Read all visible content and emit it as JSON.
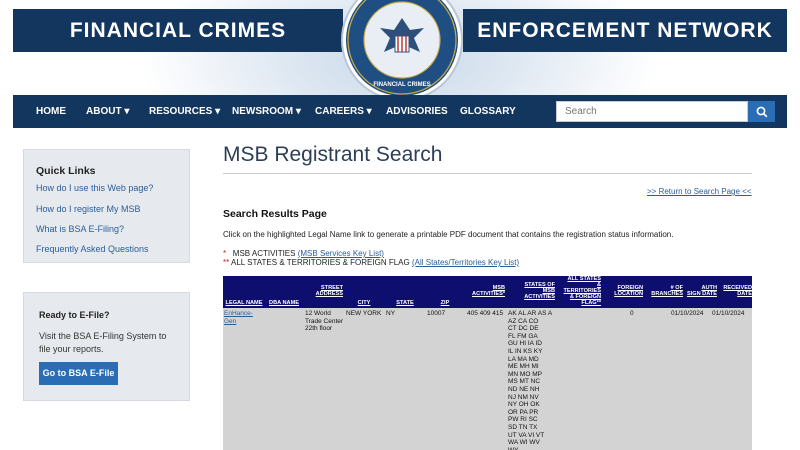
{
  "header": {
    "left_title": "FINANCIAL CRIMES",
    "right_title": "ENFORCEMENT NETWORK",
    "seal_text": "FINANCIAL CRIMES ENFORCEMENT NETWORK"
  },
  "nav": {
    "items": [
      "HOME",
      "ABOUT ▾",
      "RESOURCES ▾",
      "NEWSROOM ▾",
      "CAREERS ▾",
      "ADVISORIES",
      "GLOSSARY"
    ],
    "search_placeholder": "Search"
  },
  "sidebar": {
    "quick_links_title": "Quick Links",
    "links": [
      "How do I use this Web page?",
      "How do I register My MSB",
      "What is BSA E-Filing?",
      "Frequently Asked Questions"
    ],
    "efile_title": "Ready to E-File?",
    "efile_text_1": "Visit the BSA E-Filing System to",
    "efile_text_2": "file your reports.",
    "efile_button": "Go to BSA E-File"
  },
  "main": {
    "title": "MSB Registrant Search",
    "return_link": ">> Return to Search Page <<",
    "results_heading": "Search Results Page",
    "instructions": "Click on the highlighted Legal Name link to generate a printable PDF document that contains the registration status information.",
    "legend_msb_prefix": "*",
    "legend_msb_label": "MSB ACTIVITIES",
    "legend_msb_link": "(MSB Services Key List)",
    "legend_states_prefix": "**",
    "legend_states_label": "ALL STATES & TERRITORIES & FOREIGN FLAG",
    "legend_states_link": "(All States/Territories Key List)"
  },
  "table": {
    "headers": {
      "legal_name": "LEGAL NAME",
      "dba_name": "DBA NAME",
      "street_1": "STREET",
      "street_2": "ADDRESS",
      "city": "CITY",
      "state": "STATE",
      "zip": "ZIP",
      "msb_1": "MSB",
      "msb_2": "ACTIVITIES*",
      "states_1": "STATES OF",
      "states_2": "MSB",
      "states_3": "ACTIVITIES",
      "allstates_1": "ALL STATES",
      "allstates_2": "&",
      "allstates_3": "TERRITORIES",
      "allstates_4": "& FOREIGN",
      "allstates_5": "FLAG**",
      "foreign_1": "FOREIGN",
      "foreign_2": "LOCATION",
      "branches_1": "# OF",
      "branches_2": "BRANCHES",
      "auth_1": "AUTH",
      "auth_2": "SIGN DATE",
      "received_1": "RECEIVED",
      "received_2": "DATE"
    },
    "row": {
      "legal_name_1": "EnHance-",
      "legal_name_2": "Gen",
      "street_1": "12 World",
      "street_2": "Trade Center",
      "street_3": "22th floor",
      "city": "NEW YORK",
      "state": "NY",
      "zip": "10007",
      "msb": "405 409 415",
      "states_lines": [
        "AK AL AR AS A",
        "AZ CA CO",
        "CT DC DE",
        "FL FM GA",
        "GU HI IA ID",
        "IL IN KS KY",
        "LA MA MD",
        "ME MH MI",
        "MN MO MP",
        "MS MT NC",
        "ND NE NH",
        "NJ NM NV",
        "NY OH OK",
        "OR PA PR",
        "PW RI SC",
        "SD TN TX",
        "UT VA VI VT",
        "WA WI WV",
        "WY"
      ],
      "branches": "0",
      "auth_date": "01/10/2024",
      "received_date": "01/10/2024"
    }
  }
}
